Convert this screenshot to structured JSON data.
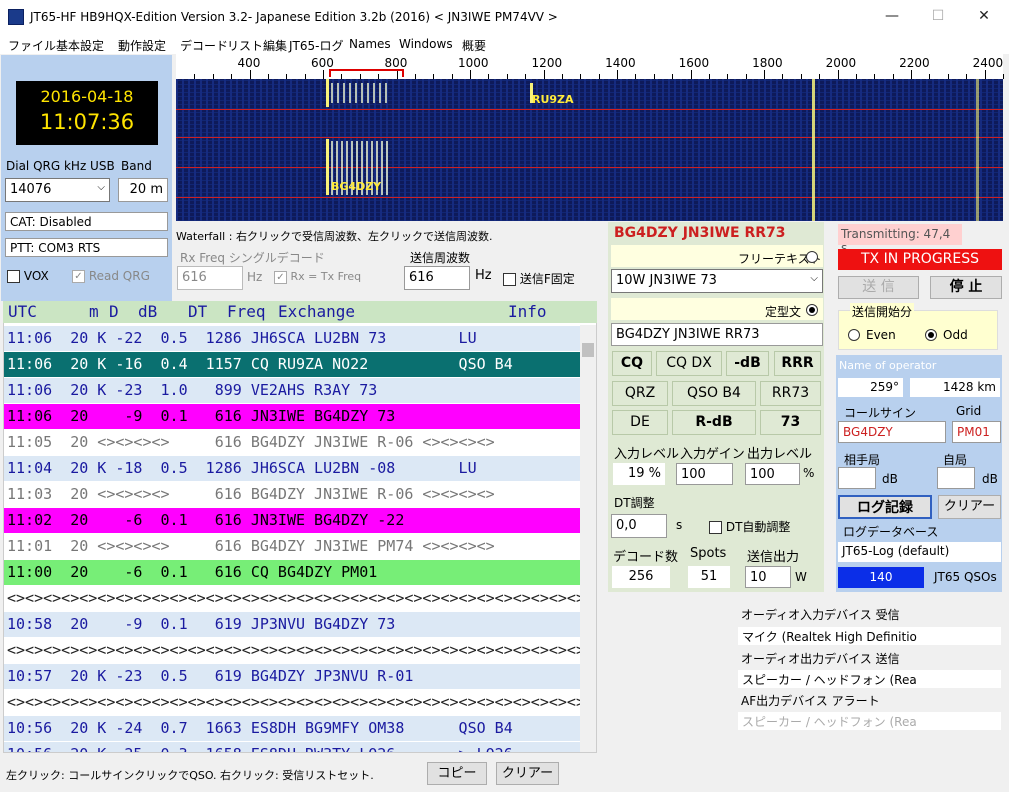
{
  "window": {
    "title": "JT65-HF HB9HQX-Edition Version 3.2- Japanese Edition 3.2b (2016)   < JN3IWE PM74VV >",
    "minimize": "—",
    "maximize": "☐",
    "close": "✕"
  },
  "menu": [
    "ファイル",
    "基本設定",
    "動作設定",
    "デコード",
    "リスト編集",
    "JT65-ログ",
    "Names",
    "Windows",
    "概要"
  ],
  "clock": {
    "date": "2016-04-18",
    "time": "11:07:36"
  },
  "dial": {
    "label": "Dial QRG kHz USB",
    "value": "14076",
    "band_label": "Band",
    "band": "20 m"
  },
  "cat": "CAT: Disabled",
  "ptt": "PTT: COM3 RTS",
  "vox": "VOX",
  "read_qrg": "Read QRG",
  "scale": [
    "400",
    "600",
    "800",
    "1000",
    "1200",
    "1400",
    "1600",
    "1800",
    "2000",
    "2200",
    "2400"
  ],
  "waterfall": {
    "labels": [
      "RU9ZA",
      "BG4DZY"
    ],
    "hint": "Waterfall : 右クリックで受信周波数、左クリックで送信周波数.",
    "rx_freq_label": "Rx Freq シングルデコード",
    "rx_freq": "616",
    "hz": "Hz",
    "rx_eq_tx": "Rx = Tx Freq",
    "tx_freq_label": "送信周波数",
    "tx_freq": "616",
    "tx_fixed": "送信F固定"
  },
  "list": {
    "headers": [
      "UTC",
      "m",
      "D",
      "dB",
      "DT",
      "Freq",
      "Exchange",
      "Info"
    ],
    "rows": [
      {
        "text": "11:06  20 K -22  0.5  1286 JH6SCA LU2BN 73        LU",
        "bg": "#dce8f5",
        "fg": "#1a1aa0"
      },
      {
        "text": "11:06  20 K -16  0.4  1157 CQ RU9ZA NO22          QSO B4",
        "bg": "#0a7070",
        "fg": "#ffffff"
      },
      {
        "text": "11:06  20 K -23  1.0   899 VE2AHS R3AY 73",
        "bg": "#dce8f5",
        "fg": "#1a1aa0"
      },
      {
        "text": "11:06  20    -9  0.1   616 JN3IWE BG4DZY 73",
        "bg": "#ff00ff",
        "fg": "#000000"
      },
      {
        "text": "11:05  20 <><><><>     616 BG4DZY JN3IWE R-06 <><><><>",
        "bg": "#ffffff",
        "fg": "#777777"
      },
      {
        "text": "11:04  20 K -18  0.5  1286 JH6SCA LU2BN -08       LU",
        "bg": "#dce8f5",
        "fg": "#1a1aa0"
      },
      {
        "text": "11:03  20 <><><><>     616 BG4DZY JN3IWE R-06 <><><><>",
        "bg": "#ffffff",
        "fg": "#777777"
      },
      {
        "text": "11:02  20    -6  0.1   616 JN3IWE BG4DZY -22",
        "bg": "#ff00ff",
        "fg": "#000000"
      },
      {
        "text": "11:01  20 <><><><>     616 BG4DZY JN3IWE PM74 <><><><>",
        "bg": "#ffffff",
        "fg": "#777777"
      },
      {
        "text": "11:00  20    -6  0.1   616 CQ BG4DZY PM01",
        "bg": "#77ee77",
        "fg": "#000000"
      },
      {
        "text": "<><><><><><><><><><><><><><><><><><><><><><><><><><><><><><><><><>",
        "bg": "#ffffff",
        "fg": "#222222"
      },
      {
        "text": "10:58  20    -9  0.1   619 JP3NVU BG4DZY 73",
        "bg": "#dce8f5",
        "fg": "#1a1aa0"
      },
      {
        "text": "<><><><><><><><><><><><><><><><><><><><><><><><><><><><><><><><><>",
        "bg": "#ffffff",
        "fg": "#222222"
      },
      {
        "text": "10:57  20 K -23  0.5   619 BG4DZY JP3NVU R-01",
        "bg": "#dce8f5",
        "fg": "#1a1aa0"
      },
      {
        "text": "<><><><><><><><><><><><><><><><><><><><><><><><><><><><><><><><><>",
        "bg": "#ffffff",
        "fg": "#222222"
      },
      {
        "text": "10:56  20 K -24  0.7  1663 ES8DH BG9MFY OM38      QSO B4",
        "bg": "#dce8f5",
        "fg": "#1a1aa0"
      },
      {
        "text": "10:56  20 K -25  0.3  1658 ES8DH RW3TY LO26       > LO26",
        "bg": "#dce8f5",
        "fg": "#1a1aa0"
      }
    ]
  },
  "status_bar": "左クリック: コールサインクリックでQSO. 右クリック: 受信リストセット.",
  "copy_button": "コピー",
  "clear_button": "クリアー",
  "tx": {
    "current_msg": "BG4DZY JN3IWE RR73",
    "free_text_label": "フリーテキスト",
    "free_text": "10W JN3IWE 73",
    "fixed_label": "定型文",
    "fixed_msg": "BG4DZY JN3IWE RR73",
    "buttons": [
      "CQ",
      "CQ DX",
      "-dB",
      "RRR",
      "QRZ",
      "QSO B4",
      "RR73",
      "DE",
      "R-dB",
      "73"
    ],
    "input_level_label": "入力レベル",
    "input_level": "19 %",
    "input_gain_label": "入力ゲイン",
    "input_gain": "100",
    "output_level_label": "出力レベル",
    "output_level": "100",
    "percent": "%",
    "dt_adjust_label": "DT調整",
    "dt_value": "0,0",
    "seconds": "s",
    "dt_auto": "DT自動調整",
    "decode_count_label": "デコード数",
    "decode_count": "256",
    "spots_label": "Spots",
    "spots": "51",
    "tx_power_label": "送信出力",
    "tx_power": "10",
    "watt": "W"
  },
  "right": {
    "transmitting": "Transmitting: 47,4 s",
    "tx_in_progress": "TX IN PROGRESS",
    "send": "送 信",
    "stop": "停 止",
    "tx_start_group": "送信開始分",
    "even": "Even",
    "odd": "Odd",
    "operator_placeholder": "Name of operator",
    "bearing": "259°",
    "distance": "1428 km",
    "callsign_label": "コールサイン",
    "grid_label": "Grid",
    "callsign": "BG4DZY",
    "grid": "PM01",
    "their_label": "相手局",
    "my_label": "自局",
    "db": "dB",
    "log_button": "ログ記録",
    "clear_button": "クリアー",
    "log_db_label": "ログデータベース",
    "log_db": "JT65-Log (default)",
    "qso_count": "140",
    "qso_label": "JT65 QSOs"
  },
  "audio": {
    "in_label": "オーディオ入力デバイス  受信",
    "in_device": "マイク (Realtek High Definitio",
    "out_label": "オーディオ出力デバイス  送信",
    "out_device": "スピーカー / ヘッドフォン (Rea",
    "af_label": "AF出力デバイス  アラート",
    "af_device": "スピーカー / ヘッドフォン (Rea"
  },
  "colors": {
    "accent_red": "#cc2020",
    "tx_red": "#ee1111",
    "qso_blue": "#0b2ee8"
  }
}
